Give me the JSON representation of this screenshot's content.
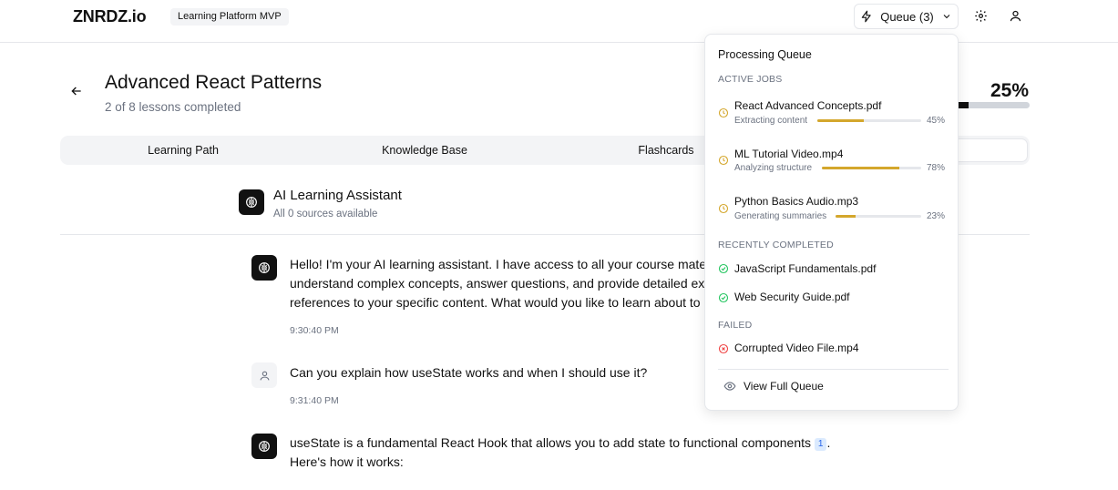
{
  "header": {
    "logo": "ZNRDZ.io",
    "badge": "Learning Platform MVP",
    "queue_label": "Queue (3)",
    "icons": [
      "zap-icon",
      "chevron-down-icon",
      "gear-icon",
      "user-icon"
    ]
  },
  "course": {
    "title": "Advanced React Patterns",
    "subtitle": "2 of 8 lessons completed",
    "progress_label": "25%",
    "progress": 0.25
  },
  "tabs": [
    {
      "label": "Learning Path"
    },
    {
      "label": "Knowledge Base"
    },
    {
      "label": "Flashcards"
    }
  ],
  "assistant": {
    "title": "AI Learning Assistant",
    "subtitle": "All 0 sources available"
  },
  "messages": [
    {
      "role": "assistant",
      "lines": [
        "Hello! I'm your AI learning assistant. I have access to all your course mater",
        "understand complex concepts, answer questions, and provide detailed exp",
        "references to your specific content. What would you like to learn about to"
      ],
      "time": "9:30:40 PM"
    },
    {
      "role": "user",
      "lines": [
        "Can you explain how useState works and when I should use it?"
      ],
      "time": "9:31:40 PM"
    },
    {
      "role": "assistant",
      "line1": "useState is a fundamental React Hook that allows you to add state to functional components",
      "citation": "1",
      "line1_end": ".",
      "line2": "Here's how it works:"
    }
  ],
  "queue": {
    "title": "Processing Queue",
    "active_label": "ACTIVE JOBS",
    "active": [
      {
        "name": "React Advanced Concepts.pdf",
        "status": "Extracting content",
        "progress": 0.45,
        "pct": "45%"
      },
      {
        "name": "ML Tutorial Video.mp4",
        "status": "Analyzing structure",
        "progress": 0.78,
        "pct": "78%"
      },
      {
        "name": "Python Basics Audio.mp3",
        "status": "Generating summaries",
        "progress": 0.23,
        "pct": "23%"
      }
    ],
    "completed_label": "RECENTLY COMPLETED",
    "completed": [
      {
        "name": "JavaScript Fundamentals.pdf"
      },
      {
        "name": "Web Security Guide.pdf"
      }
    ],
    "failed_label": "FAILED",
    "failed": [
      {
        "name": "Corrupted Video File.mp4"
      }
    ],
    "view_full": "View Full Queue"
  },
  "colors": {
    "accent": "#111111",
    "progress_job": "#d4a72c",
    "success": "#22c55e",
    "error": "#ef4444",
    "citation": "#2563eb"
  }
}
